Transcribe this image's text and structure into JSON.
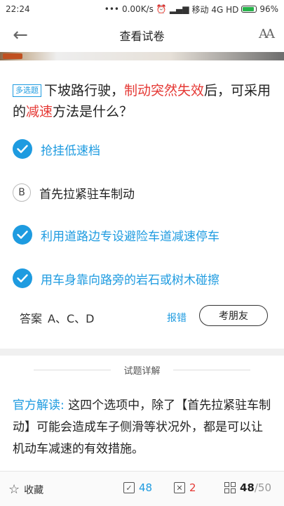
{
  "status": {
    "time": "22:24",
    "speed": "0.00K/s",
    "carrier": "移动 4G HD",
    "battery": "96%"
  },
  "header": {
    "title": "查看试卷"
  },
  "question": {
    "type": "多选题",
    "text_parts": [
      "下坡路行驶，",
      "制动突然失效",
      "后，可采用的",
      "减速",
      "方法是什么？"
    ]
  },
  "options": [
    {
      "letter": "A",
      "text": "抢挂低速档",
      "selected": true
    },
    {
      "letter": "B",
      "text": "首先拉紧驻车制动",
      "selected": false
    },
    {
      "letter": "C",
      "text": "利用道路边专设避险车道减速停车",
      "selected": true
    },
    {
      "letter": "D",
      "text": "用车身靠向路旁的岩石或树木碰擦",
      "selected": true
    }
  ],
  "answer": {
    "label": "答案",
    "value": "A、C、D",
    "report": "报错",
    "ask_friend": "考朋友"
  },
  "detail": {
    "title": "试题详解",
    "label": "官方解读:",
    "text": "这四个选项中，除了【首先拉紧驻车制动】可能会造成车子侧滑等状况外，都是可以让机动车减速的有效措施。"
  },
  "bottom": {
    "favorite": "收藏",
    "correct": "48",
    "wrong": "2",
    "progress_current": "48",
    "progress_total": "/50"
  },
  "colors": {
    "accent": "#1e9be0",
    "highlight": "#e53935"
  }
}
